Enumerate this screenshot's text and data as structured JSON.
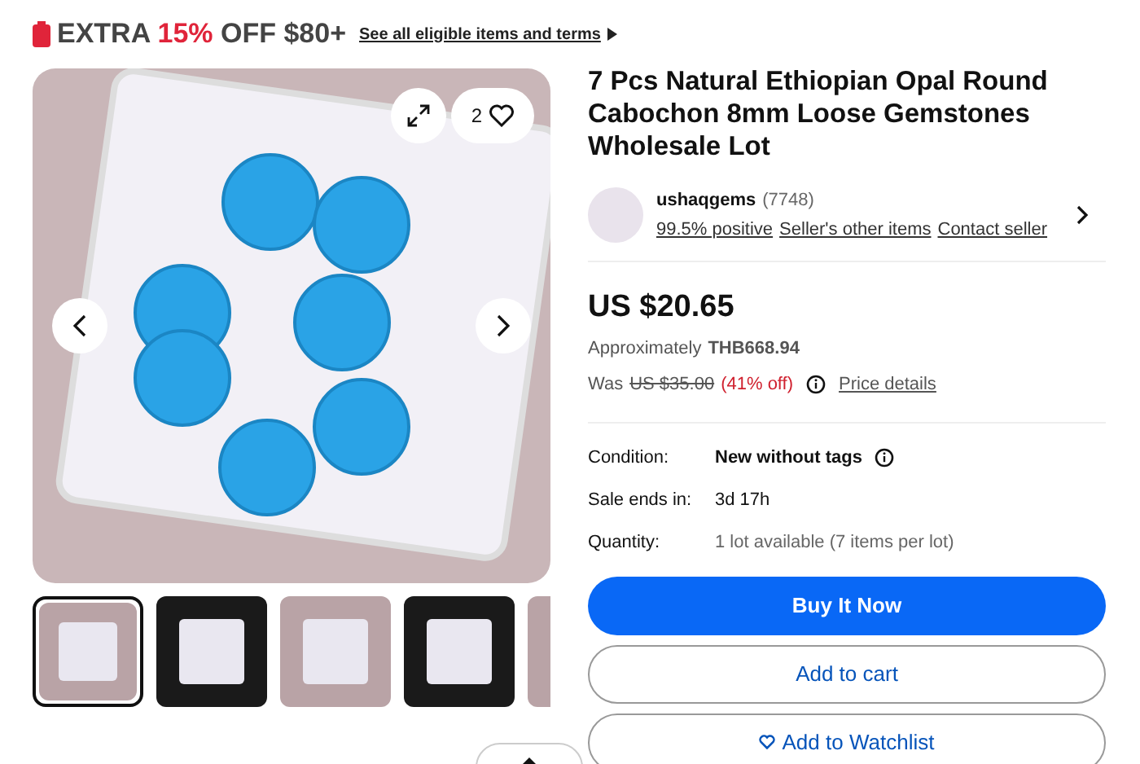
{
  "promo": {
    "prefix": "EXTRA",
    "highlight": "15%",
    "suffix": "OFF $80+",
    "link": "See all eligible items and terms"
  },
  "gallery": {
    "watch_count": "2",
    "thumbnails": [
      {
        "selected": true
      },
      {
        "selected": false
      },
      {
        "selected": false
      },
      {
        "selected": false
      },
      {
        "selected": false
      }
    ]
  },
  "title": "7 Pcs Natural Ethiopian Opal Round Cabochon 8mm Loose Gemstones Wholesale Lot",
  "seller": {
    "name": "ushaqgems",
    "count": "(7748)",
    "links": [
      "99.5% positive",
      "Seller's other items",
      "Contact seller"
    ]
  },
  "price": {
    "amount": "US $20.65",
    "approx_label": "Approximately",
    "approx_value": "THB668.94",
    "was_label": "Was",
    "was_value": "US $35.00",
    "discount": "(41% off)",
    "details": "Price details"
  },
  "details": [
    {
      "label": "Condition:",
      "value": "New without tags",
      "kind": "info"
    },
    {
      "label": "Sale ends in:",
      "value": "3d 17h",
      "kind": "plain"
    },
    {
      "label": "Quantity:",
      "value": "1 lot available (7 items per lot)",
      "kind": "muted"
    }
  ],
  "buttons": [
    {
      "label": "Buy It Now",
      "kind": "primary"
    },
    {
      "label": "Add to cart",
      "kind": "secondary"
    },
    {
      "label": "Add to Watchlist",
      "kind": "watch"
    }
  ]
}
